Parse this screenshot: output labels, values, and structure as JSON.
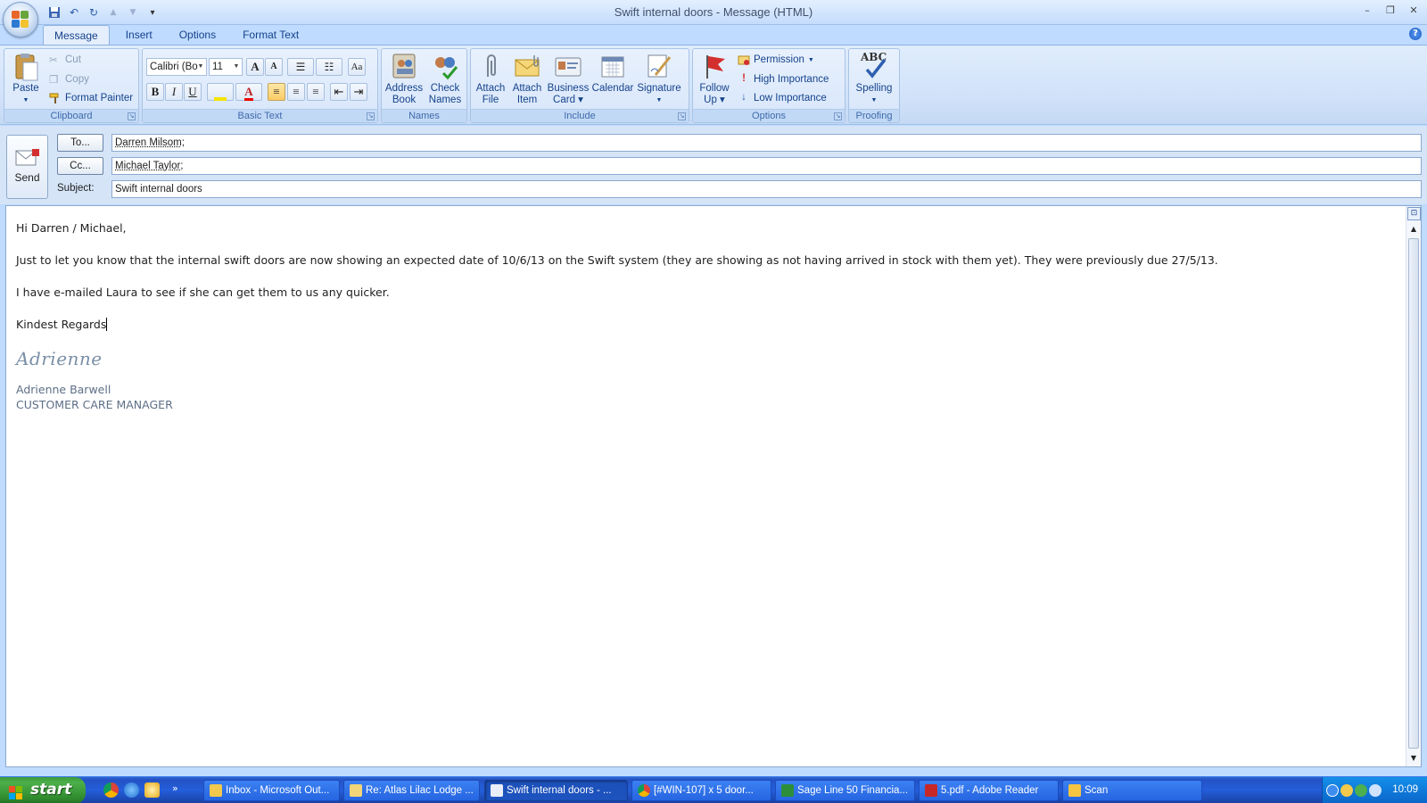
{
  "window": {
    "title": "Swift internal doors - Message (HTML)",
    "minimize": "–",
    "restore": "❐",
    "close": "✕"
  },
  "quick_access": {
    "save": "💾",
    "undo": "↶",
    "redo": "↻",
    "up": "▲",
    "down": "▼",
    "customize": "▾"
  },
  "tabs": [
    {
      "label": "Message",
      "active": true
    },
    {
      "label": "Insert",
      "active": false
    },
    {
      "label": "Options",
      "active": false
    },
    {
      "label": "Format Text",
      "active": false
    }
  ],
  "help": "?",
  "ribbon": {
    "clipboard": {
      "label": "Clipboard",
      "paste": "Paste",
      "cut": "Cut",
      "copy": "Copy",
      "format_painter": "Format Painter"
    },
    "basic_text": {
      "label": "Basic Text",
      "font": "Calibri (Bo",
      "size": "11",
      "grow": "A",
      "shrink": "A",
      "bold": "B",
      "italic": "I",
      "underline": "U"
    },
    "names": {
      "label": "Names",
      "address_book": [
        "Address",
        "Book"
      ],
      "check_names": [
        "Check",
        "Names"
      ]
    },
    "include": {
      "label": "Include",
      "attach_file": [
        "Attach",
        "File"
      ],
      "attach_item": [
        "Attach",
        "Item"
      ],
      "business_card": [
        "Business",
        "Card ▾"
      ],
      "calendar": "Calendar",
      "signature": "Signature"
    },
    "options": {
      "label": "Options",
      "follow_up": [
        "Follow",
        "Up ▾"
      ],
      "permission": "Permission",
      "high_importance": "High Importance",
      "low_importance": "Low Importance"
    },
    "proofing": {
      "label": "Proofing",
      "spelling": "Spelling",
      "abc": "ABC"
    }
  },
  "header": {
    "send": "Send",
    "to_button": "To...",
    "cc_button": "Cc...",
    "subject_label": "Subject:",
    "to_value": "Darren Milsom",
    "cc_value": "Michael Taylor",
    "separator": ";",
    "subject_value": "Swift internal doors"
  },
  "message": {
    "greeting": "Hi Darren / Michael,",
    "para1": "Just to let you know that the internal swift doors are now showing an expected date of 10/6/13 on the Swift system (they are showing as not having arrived in stock with them yet).  They were previously due 27/5/13.",
    "para2": "I have e-mailed Laura to see if she can get them to us any quicker.",
    "closing": "Kindest Regards",
    "signature_script": "Adrienne",
    "signature_name": "Adrienne Barwell",
    "signature_title": "CUSTOMER CARE MANAGER"
  },
  "taskbar": {
    "start": "start",
    "tasks": [
      {
        "label": "Inbox - Microsoft Out...",
        "active": false,
        "color": "#f2c94c"
      },
      {
        "label": "Re: Atlas Lilac Lodge ...",
        "active": false,
        "color": "#f2d479"
      },
      {
        "label": "Swift internal doors - ...",
        "active": true,
        "color": "#e9eef8"
      },
      {
        "label": "[#WIN-107] x 5 door...",
        "active": false,
        "color": "#e4572e"
      },
      {
        "label": "Sage Line 50 Financia...",
        "active": false,
        "color": "#2d8f3c"
      },
      {
        "label": "5.pdf - Adobe Reader",
        "active": false,
        "color": "#c62828"
      },
      {
        "label": "Scan",
        "active": false,
        "color": "#f5c542"
      }
    ],
    "clock": "10:09"
  },
  "colors": {
    "accent": "#15428b",
    "ribbon_bg": "#d1e2f9",
    "taskbar": "#245edb",
    "start": "#3c9b3b"
  }
}
